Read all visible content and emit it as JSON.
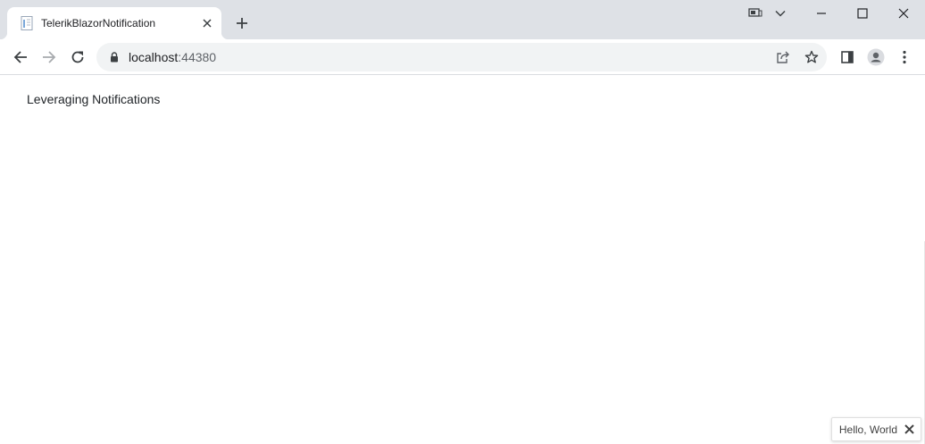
{
  "browser": {
    "tab": {
      "title": "TelerikBlazorNotification",
      "favicon": "document-icon"
    },
    "new_tab_icon": "plus-icon",
    "window_controls": [
      "tab-search-icon",
      "chevron-down-icon",
      "minimize-icon",
      "maximize-icon",
      "close-icon"
    ],
    "toolbar": {
      "back_icon": "arrow-left-icon",
      "forward_icon": "arrow-right-icon",
      "reload_icon": "reload-icon",
      "url_host": "localhost",
      "url_port": ":44380",
      "share_icon": "share-icon",
      "bookmark_icon": "star-icon",
      "side_panel_icon": "side-panel-icon",
      "profile_icon": "avatar-icon",
      "menu_icon": "kebab-menu-icon"
    }
  },
  "page": {
    "heading": "Leveraging Notifications",
    "notification": {
      "text": "Hello, World",
      "close_icon": "close-icon"
    }
  },
  "colors": {
    "tabstrip_bg": "#dee1e6",
    "omnibox_bg": "#f1f3f4",
    "text": "#202124",
    "icon": "#5f6368"
  }
}
